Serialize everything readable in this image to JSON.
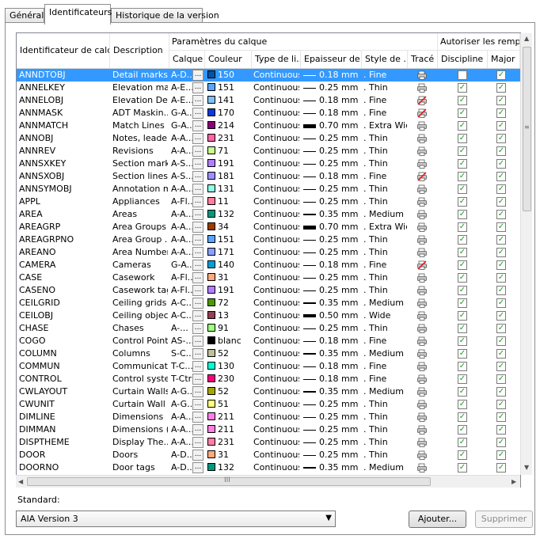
{
  "tabs": [
    {
      "label": "Général",
      "active": false
    },
    {
      "label": "Identificateurs",
      "active": true
    },
    {
      "label": "Historique de la version",
      "active": false
    }
  ],
  "table": {
    "group_headers": {
      "params": "Paramètres du calque",
      "overrides": "Autoriser les remplace"
    },
    "columns": [
      "Identificateur de calq...",
      "Description",
      "Calque",
      "Couleur",
      "Type de li...",
      "Epaisseur de...",
      "Style de ...",
      "Tracé",
      "Discipline ...",
      "Major"
    ],
    "rows": [
      [
        "ANNDTOBJ",
        "Detail marks",
        "A-D...",
        "150",
        "#0054a8",
        "Continuous",
        "0.18 mm",
        "Fine",
        "plot",
        false,
        true
      ],
      [
        "ANNELKEY",
        "Elevation ma...",
        "A-E...",
        "151",
        "#5aa5ff",
        "Continuous",
        "0.25 mm",
        "Thin",
        "plot",
        true,
        true
      ],
      [
        "ANNELOBJ",
        "Elevation De...",
        "A-E...",
        "141",
        "#7fc0f5",
        "Continuous",
        "0.18 mm",
        "Fine",
        "noplot",
        true,
        true
      ],
      [
        "ANNMASK",
        "ADT Maskin...",
        "G-A...",
        "170",
        "#0a3ad8",
        "Continuous",
        "0.18 mm",
        "Fine",
        "noplot",
        true,
        true
      ],
      [
        "ANNMATCH",
        "Match Lines",
        "G-A...",
        "214",
        "#8a007a",
        "Continuous",
        "0.70 mm",
        "Extra Wide",
        "plot",
        true,
        true
      ],
      [
        "ANNOBJ",
        "Notes, leader...",
        "A-A...",
        "231",
        "#ff66a8",
        "Continuous",
        "0.25 mm",
        "Thin",
        "plot",
        true,
        true
      ],
      [
        "ANNREV",
        "Revisions",
        "A-A...",
        "71",
        "#c8ff8c",
        "Continuous",
        "0.25 mm",
        "Thin",
        "plot",
        true,
        true
      ],
      [
        "ANNSXKEY",
        "Section marks",
        "A-S...",
        "191",
        "#b47fff",
        "Continuous",
        "0.25 mm",
        "Thin",
        "plot",
        true,
        true
      ],
      [
        "ANNSXOBJ",
        "Section lines",
        "A-S...",
        "181",
        "#9f8fff",
        "Continuous",
        "0.18 mm",
        "Fine",
        "noplot",
        true,
        true
      ],
      [
        "ANNSYMOBJ",
        "Annotation m...",
        "A-A...",
        "131",
        "#8fffe6",
        "Continuous",
        "0.25 mm",
        "Thin",
        "plot",
        true,
        true
      ],
      [
        "APPL",
        "Appliances",
        "A-Fl...",
        "11",
        "#ff7f9f",
        "Continuous",
        "0.25 mm",
        "Thin",
        "plot",
        true,
        true
      ],
      [
        "AREA",
        "Areas",
        "A-A...",
        "132",
        "#009980",
        "Continuous",
        "0.35 mm",
        "Medium",
        "plot",
        true,
        true
      ],
      [
        "AREAGRP",
        "Area Groups",
        "A-A...",
        "34",
        "#993d00",
        "Continuous",
        "0.70 mm",
        "Extra Wide",
        "plot",
        true,
        true
      ],
      [
        "AREAGRPNO",
        "Area Group ...",
        "A-A...",
        "151",
        "#5aa5ff",
        "Continuous",
        "0.25 mm",
        "Thin",
        "plot",
        true,
        true
      ],
      [
        "AREANO",
        "Area Numbers",
        "A-A...",
        "171",
        "#8aa0ff",
        "Continuous",
        "0.25 mm",
        "Thin",
        "plot",
        true,
        true
      ],
      [
        "CAMERA",
        "Cameras",
        "G-A...",
        "140",
        "#00a0d6",
        "Continuous",
        "0.18 mm",
        "Fine",
        "noplot",
        true,
        true
      ],
      [
        "CASE",
        "Casework",
        "A-Fl...",
        "31",
        "#ffaa7f",
        "Continuous",
        "0.25 mm",
        "Thin",
        "plot",
        true,
        true
      ],
      [
        "CASENO",
        "Casework tags",
        "A-Fl...",
        "191",
        "#b47fff",
        "Continuous",
        "0.25 mm",
        "Thin",
        "plot",
        true,
        true
      ],
      [
        "CEILGRID",
        "Ceiling grids",
        "A-C...",
        "72",
        "#4c9900",
        "Continuous",
        "0.35 mm",
        "Medium",
        "plot",
        true,
        true
      ],
      [
        "CEILOBJ",
        "Ceiling objects",
        "A-C...",
        "13",
        "#993d52",
        "Continuous",
        "0.50 mm",
        "Wide",
        "plot",
        true,
        true
      ],
      [
        "CHASE",
        "Chases",
        "A-...",
        "91",
        "#9fff7f",
        "Continuous",
        "0.25 mm",
        "Thin",
        "plot",
        true,
        true
      ],
      [
        "COGO",
        "Control Points",
        "AS-...",
        "blanc",
        "#000000",
        "Continuous",
        "0.18 mm",
        "Fine",
        "plot",
        true,
        true
      ],
      [
        "COLUMN",
        "Columns",
        "S-C...",
        "52",
        "#bfbf99",
        "Continuous",
        "0.35 mm",
        "Medium",
        "plot",
        true,
        true
      ],
      [
        "COMMUN",
        "Communication",
        "T-C...",
        "130",
        "#00ffd8",
        "Continuous",
        "0.18 mm",
        "Fine",
        "plot",
        true,
        true
      ],
      [
        "CONTROL",
        "Control syste...",
        "T-Ctrl",
        "230",
        "#ff0080",
        "Continuous",
        "0.18 mm",
        "Fine",
        "plot",
        true,
        true
      ],
      [
        "CWLAYOUT",
        "Curtain Walls",
        "A-G...",
        "52",
        "#a6a600",
        "Continuous",
        "0.35 mm",
        "Medium",
        "plot",
        true,
        true
      ],
      [
        "CWUNIT",
        "Curtain Wall ...",
        "A-G...",
        "51",
        "#ffff7f",
        "Continuous",
        "0.25 mm",
        "Thin",
        "plot",
        true,
        true
      ],
      [
        "DIMLINE",
        "Dimensions",
        "A-A...",
        "211",
        "#ff7fe6",
        "Continuous",
        "0.25 mm",
        "Thin",
        "plot",
        true,
        true
      ],
      [
        "DIMMAN",
        "Dimensions (...",
        "A-A...",
        "211",
        "#ff7fe6",
        "Continuous",
        "0.25 mm",
        "Thin",
        "plot",
        true,
        true
      ],
      [
        "DISPTHEME",
        "Display The...",
        "A-A...",
        "231",
        "#ff7fa8",
        "Continuous",
        "0.25 mm",
        "Thin",
        "plot",
        true,
        true
      ],
      [
        "DOOR",
        "Doors",
        "A-D...",
        "31",
        "#ffaa7f",
        "Continuous",
        "0.25 mm",
        "Thin",
        "plot",
        true,
        true
      ],
      [
        "DOORNO",
        "Door tags",
        "A-D...",
        "132",
        "#009980",
        "Continuous",
        "0.35 mm",
        "Medium",
        "plot",
        true,
        true
      ]
    ]
  },
  "scroll": {
    "h_thumb_label": "III"
  },
  "standard": {
    "label": "Standard:",
    "value": "AIA Version 3"
  },
  "buttons": {
    "add": "Ajouter...",
    "remove": "Supprimer"
  }
}
